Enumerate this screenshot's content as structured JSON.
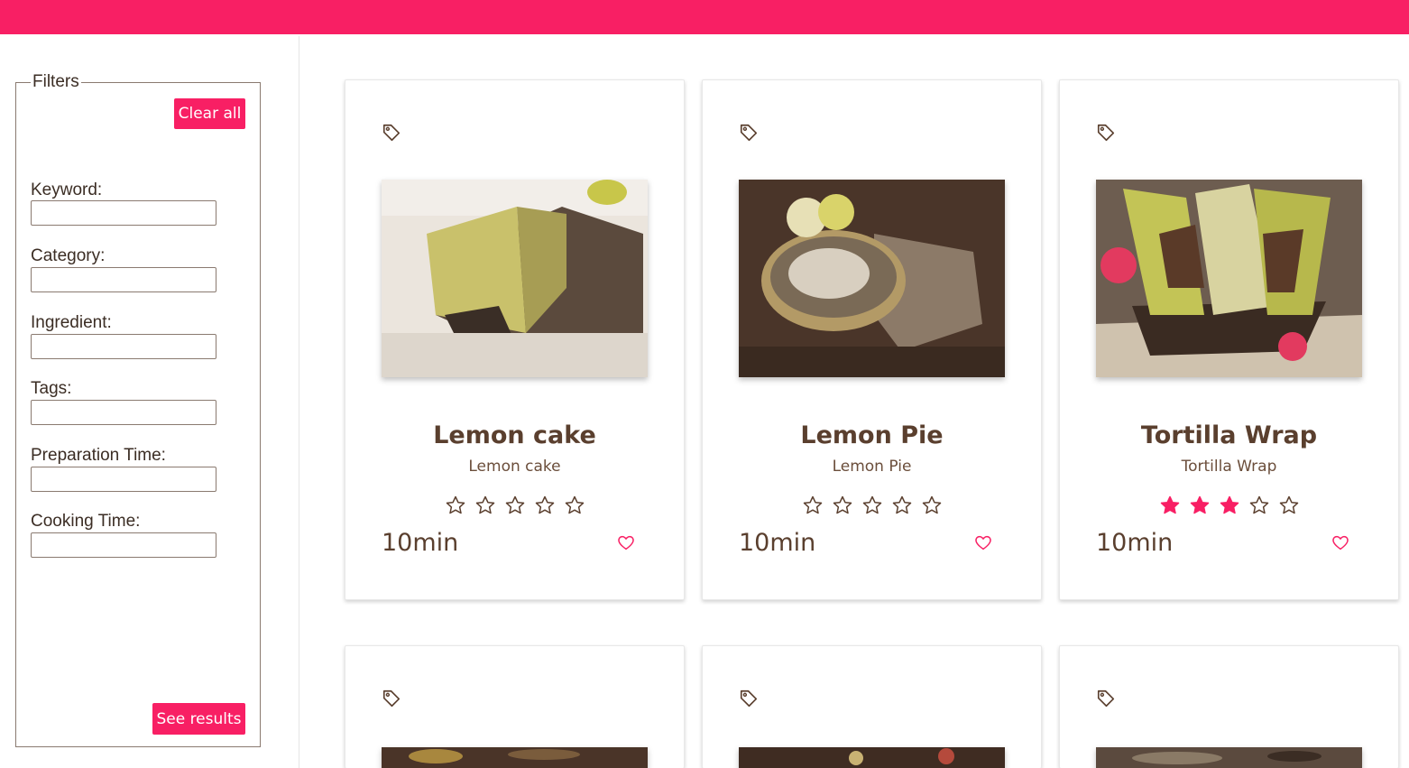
{
  "colors": {
    "accent": "#f81f64",
    "text": "#5a3f2e",
    "star_filled": "#f81f64"
  },
  "filters": {
    "legend": "Filters",
    "clear_label": "Clear all",
    "see_results_label": "See results",
    "fields": [
      {
        "label": "Keyword:",
        "value": ""
      },
      {
        "label": "Category:",
        "value": ""
      },
      {
        "label": "Ingredient:",
        "value": ""
      },
      {
        "label": "Tags:",
        "value": ""
      },
      {
        "label": "Preparation Time:",
        "value": ""
      },
      {
        "label": "Cooking Time:",
        "value": ""
      }
    ]
  },
  "recipes": [
    {
      "title": "Lemon cake",
      "subtitle": "Lemon cake",
      "rating": 0,
      "max_rating": 5,
      "time": "10min",
      "icon": "tag-icon",
      "favorite_icon": "heart-icon"
    },
    {
      "title": "Lemon Pie",
      "subtitle": "Lemon Pie",
      "rating": 0,
      "max_rating": 5,
      "time": "10min",
      "icon": "tag-icon",
      "favorite_icon": "heart-icon"
    },
    {
      "title": "Tortilla Wrap",
      "subtitle": "Tortilla Wrap",
      "rating": 3,
      "max_rating": 5,
      "time": "10min",
      "icon": "tag-icon",
      "favorite_icon": "heart-icon"
    }
  ],
  "recipes_row2": [
    {
      "icon": "tag-icon"
    },
    {
      "icon": "tag-icon"
    },
    {
      "icon": "tag-icon"
    }
  ]
}
